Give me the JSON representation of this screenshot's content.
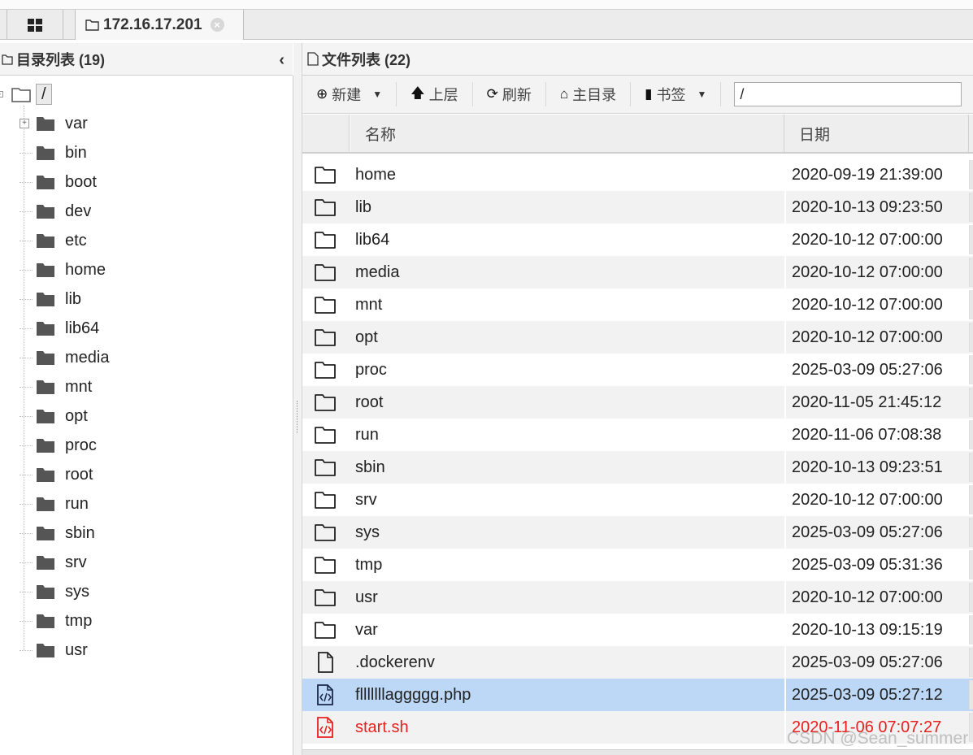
{
  "tabs": {
    "host_label": "172.16.17.201",
    "close_symbol": "⊗"
  },
  "left_panel": {
    "title": "目录列表 (19)",
    "root_label": "/",
    "items": [
      "var",
      "bin",
      "boot",
      "dev",
      "etc",
      "home",
      "lib",
      "lib64",
      "media",
      "mnt",
      "opt",
      "proc",
      "root",
      "run",
      "sbin",
      "srv",
      "sys",
      "tmp",
      "usr"
    ]
  },
  "right_panel": {
    "title": "文件列表 (22)",
    "toolbar": {
      "new_label": "新建",
      "up_label": "上层",
      "refresh_label": "刷新",
      "home_label": "主目录",
      "bookmark_label": "书签",
      "path_value": "/"
    },
    "columns": {
      "name": "名称",
      "date": "日期"
    },
    "files": [
      {
        "name": "home",
        "date": "2020-09-19 21:39:00",
        "type": "folder"
      },
      {
        "name": "lib",
        "date": "2020-10-13 09:23:50",
        "type": "folder"
      },
      {
        "name": "lib64",
        "date": "2020-10-12 07:00:00",
        "type": "folder"
      },
      {
        "name": "media",
        "date": "2020-10-12 07:00:00",
        "type": "folder"
      },
      {
        "name": "mnt",
        "date": "2020-10-12 07:00:00",
        "type": "folder"
      },
      {
        "name": "opt",
        "date": "2020-10-12 07:00:00",
        "type": "folder"
      },
      {
        "name": "proc",
        "date": "2025-03-09 05:27:06",
        "type": "folder"
      },
      {
        "name": "root",
        "date": "2020-11-05 21:45:12",
        "type": "folder"
      },
      {
        "name": "run",
        "date": "2020-11-06 07:08:38",
        "type": "folder"
      },
      {
        "name": "sbin",
        "date": "2020-10-13 09:23:51",
        "type": "folder"
      },
      {
        "name": "srv",
        "date": "2020-10-12 07:00:00",
        "type": "folder"
      },
      {
        "name": "sys",
        "date": "2025-03-09 05:27:06",
        "type": "folder"
      },
      {
        "name": "tmp",
        "date": "2025-03-09 05:31:36",
        "type": "folder"
      },
      {
        "name": "usr",
        "date": "2020-10-12 07:00:00",
        "type": "folder"
      },
      {
        "name": "var",
        "date": "2020-10-13 09:15:19",
        "type": "folder"
      },
      {
        "name": ".dockerenv",
        "date": "2025-03-09 05:27:06",
        "type": "file"
      },
      {
        "name": "flllllllaggggg.php",
        "date": "2025-03-09 05:27:12",
        "type": "code",
        "selected": true
      },
      {
        "name": "start.sh",
        "date": "2020-11-06 07:07:27",
        "type": "code-red",
        "highlight": "red"
      }
    ]
  },
  "colors": {
    "selected_row": "#bcd8f6",
    "alt_row": "#f2f2f2",
    "red_text": "#e8201e"
  },
  "watermark": "CSDN @Sean_summer"
}
